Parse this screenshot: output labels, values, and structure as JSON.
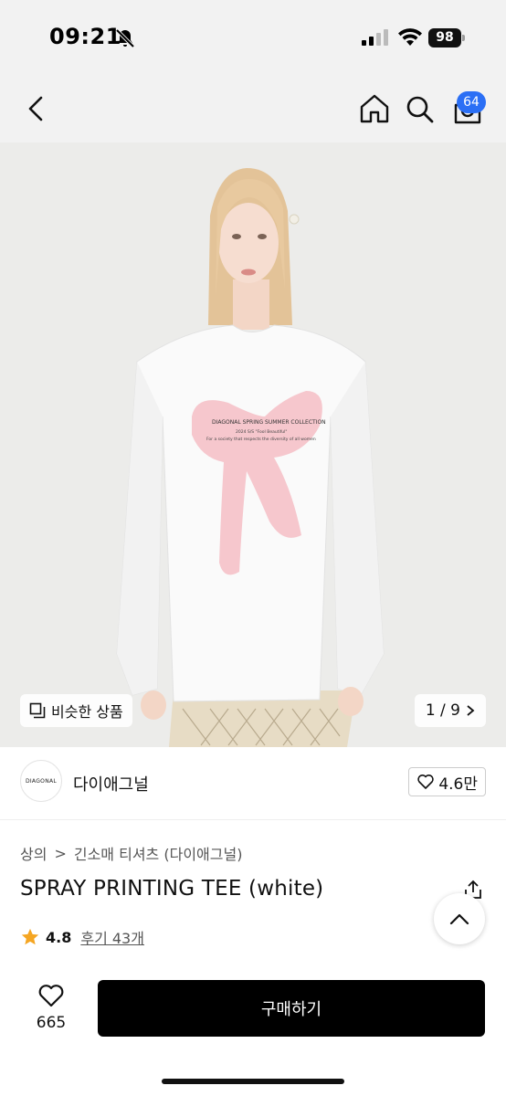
{
  "status_bar": {
    "time": "09:21",
    "battery": "98",
    "icons": [
      "bell-slash-icon",
      "signal-icon",
      "wifi-icon",
      "battery-icon"
    ]
  },
  "nav": {
    "icons": [
      "back-icon",
      "home-icon",
      "search-icon",
      "cart-icon"
    ],
    "cart_count": "64"
  },
  "image": {
    "similar_label": "비슷한 상품",
    "pager": "1 / 9",
    "shirt_print_line1": "DIAGONAL SPRING SUMMER COLLECTION",
    "shirt_print_line2": "2024 S/S \"Fool Beautiful\"",
    "shirt_print_line3": "For a society that respects the diversity of all women"
  },
  "brand": {
    "logo_text": "DIAGONAL",
    "name": "다이애그널",
    "likes": "4.6만"
  },
  "product": {
    "breadcrumb": [
      "상의",
      "긴소매 티셔츠 (다이애그널)"
    ],
    "breadcrumb_sep": ">",
    "title": "SPRAY PRINTING TEE (white)",
    "rating": "4.8",
    "reviews": "후기 43개"
  },
  "bottom": {
    "wish_count": "665",
    "buy_label": "구매하기"
  },
  "colors": {
    "accent_badge": "#2b6ff5",
    "star": "#f5a623",
    "buy_button": "#000000"
  }
}
